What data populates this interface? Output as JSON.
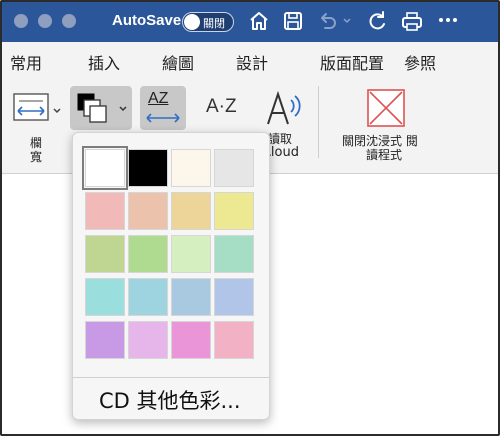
{
  "titlebar": {
    "autosave_label": "AutoSave",
    "toggle_label": "關閉",
    "bg_color": "#2b579a"
  },
  "tabs": [
    {
      "label": "常用"
    },
    {
      "label": "插入"
    },
    {
      "label": "繪圖"
    },
    {
      "label": "設計"
    },
    {
      "label": "版面配置"
    },
    {
      "label": "參照"
    }
  ],
  "ribbon": {
    "column_width_label_1": "欄",
    "column_width_label_2": "寬",
    "read_aloud_label_1": "讀取",
    "read_aloud_label_2": "Aloud",
    "close_immersive_label_1": "關閉沈浸式 閱",
    "close_immersive_label_2": "讀程式",
    "text_spacing_icon_text": "AZ",
    "syllables_icon_text": "A·Z"
  },
  "page_color_menu": {
    "swatches": [
      {
        "color": "#ffffff",
        "selected": true
      },
      {
        "color": "#000000"
      },
      {
        "color": "#fcf6eb"
      },
      {
        "color": "#e6e6e6"
      },
      {
        "color": "#f2b9b9"
      },
      {
        "color": "#ebc3ac"
      },
      {
        "color": "#edd59a"
      },
      {
        "color": "#ede992"
      },
      {
        "color": "#bfd592"
      },
      {
        "color": "#aedb8f"
      },
      {
        "color": "#d5efc0"
      },
      {
        "color": "#a6ddc5"
      },
      {
        "color": "#9adede"
      },
      {
        "color": "#9ed4e0"
      },
      {
        "color": "#a9c9e0"
      },
      {
        "color": "#b0c5e8"
      },
      {
        "color": "#c89ae6"
      },
      {
        "color": "#e6b6eb"
      },
      {
        "color": "#e995d8"
      },
      {
        "color": "#f2b1c4"
      }
    ],
    "more_colors_label": "CD 其他色彩..."
  }
}
